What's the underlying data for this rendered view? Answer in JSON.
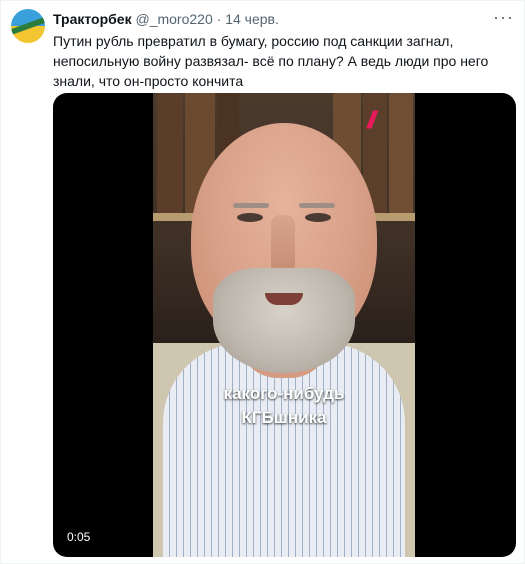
{
  "tweet": {
    "author_name": "Тракторбек",
    "author_handle": "@_moro220",
    "separator": "·",
    "date": "14 черв.",
    "more_icon": "more-horizontal-icon",
    "text": "Путин рубль превратил в бумагу, россию под санкции загнал, непосильную войну развязал- всё по плану? А ведь  люди про него знали, что он-просто кончита",
    "media": {
      "subtitle_line1": "какого-нибудь",
      "subtitle_line2": "КГБшника",
      "timestamp": "0:05",
      "brand_color": "#e61b5a"
    }
  }
}
